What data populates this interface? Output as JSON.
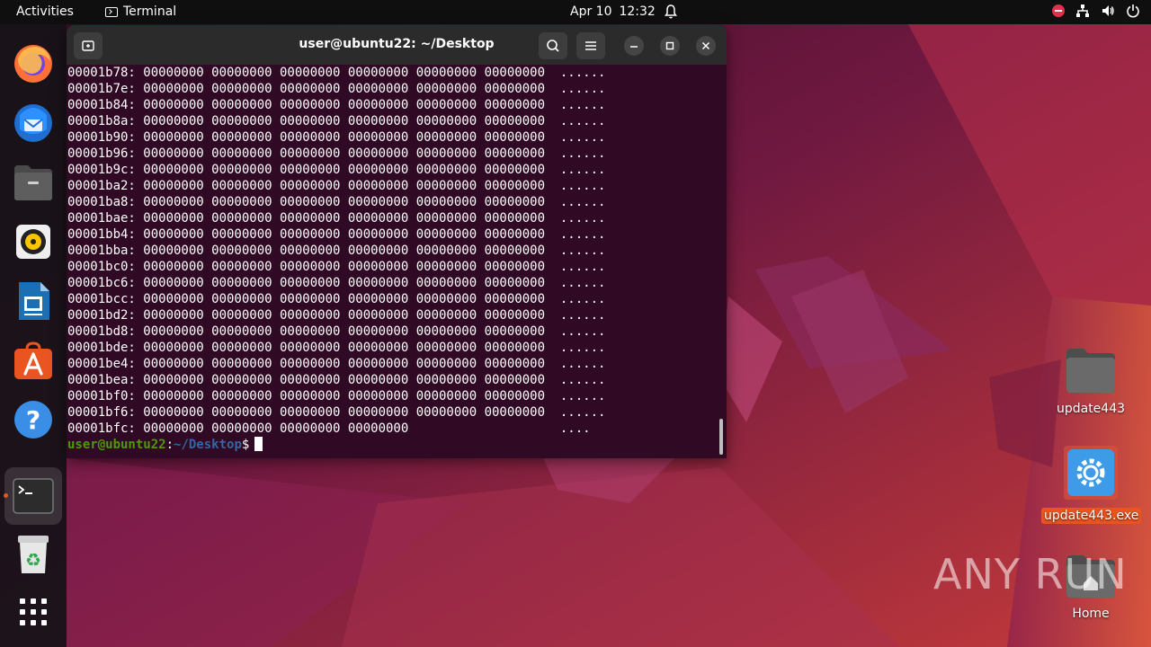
{
  "topbar": {
    "activities": "Activities",
    "app_name": "Terminal",
    "date": "Apr 10",
    "time": "12:32"
  },
  "dock": {
    "items": [
      "firefox-icon",
      "thunderbird-icon",
      "files-icon",
      "rhythmbox-icon",
      "libreoffice-writer-icon",
      "app-center-icon",
      "help-icon",
      "terminal-icon",
      "trash-icon",
      "show-apps-icon"
    ]
  },
  "terminal": {
    "title": "user@ubuntu22: ~/Desktop",
    "lines": [
      "00001b78: 00000000 00000000 00000000 00000000 00000000 00000000  ......",
      "00001b7e: 00000000 00000000 00000000 00000000 00000000 00000000  ......",
      "00001b84: 00000000 00000000 00000000 00000000 00000000 00000000  ......",
      "00001b8a: 00000000 00000000 00000000 00000000 00000000 00000000  ......",
      "00001b90: 00000000 00000000 00000000 00000000 00000000 00000000  ......",
      "00001b96: 00000000 00000000 00000000 00000000 00000000 00000000  ......",
      "00001b9c: 00000000 00000000 00000000 00000000 00000000 00000000  ......",
      "00001ba2: 00000000 00000000 00000000 00000000 00000000 00000000  ......",
      "00001ba8: 00000000 00000000 00000000 00000000 00000000 00000000  ......",
      "00001bae: 00000000 00000000 00000000 00000000 00000000 00000000  ......",
      "00001bb4: 00000000 00000000 00000000 00000000 00000000 00000000  ......",
      "00001bba: 00000000 00000000 00000000 00000000 00000000 00000000  ......",
      "00001bc0: 00000000 00000000 00000000 00000000 00000000 00000000  ......",
      "00001bc6: 00000000 00000000 00000000 00000000 00000000 00000000  ......",
      "00001bcc: 00000000 00000000 00000000 00000000 00000000 00000000  ......",
      "00001bd2: 00000000 00000000 00000000 00000000 00000000 00000000  ......",
      "00001bd8: 00000000 00000000 00000000 00000000 00000000 00000000  ......",
      "00001bde: 00000000 00000000 00000000 00000000 00000000 00000000  ......",
      "00001be4: 00000000 00000000 00000000 00000000 00000000 00000000  ......",
      "00001bea: 00000000 00000000 00000000 00000000 00000000 00000000  ......",
      "00001bf0: 00000000 00000000 00000000 00000000 00000000 00000000  ......",
      "00001bf6: 00000000 00000000 00000000 00000000 00000000 00000000  ......",
      "00001bfc: 00000000 00000000 00000000 00000000                    ...."
    ],
    "prompt_user": "user@ubuntu22",
    "prompt_sep": ":",
    "prompt_path": "~/Desktop",
    "prompt_symbol": "$"
  },
  "desktop": {
    "icons": [
      {
        "label": "update443",
        "icon": "folder-icon"
      },
      {
        "label": "update443.exe",
        "icon": "exe-icon"
      },
      {
        "label": "Home",
        "icon": "home-folder-icon"
      }
    ]
  },
  "watermark": "ANY RUN",
  "colors": {
    "terminal_bg": "#300a24",
    "prompt_user": "#4e9a06",
    "prompt_path": "#3465a4",
    "accent": "#e95420"
  }
}
